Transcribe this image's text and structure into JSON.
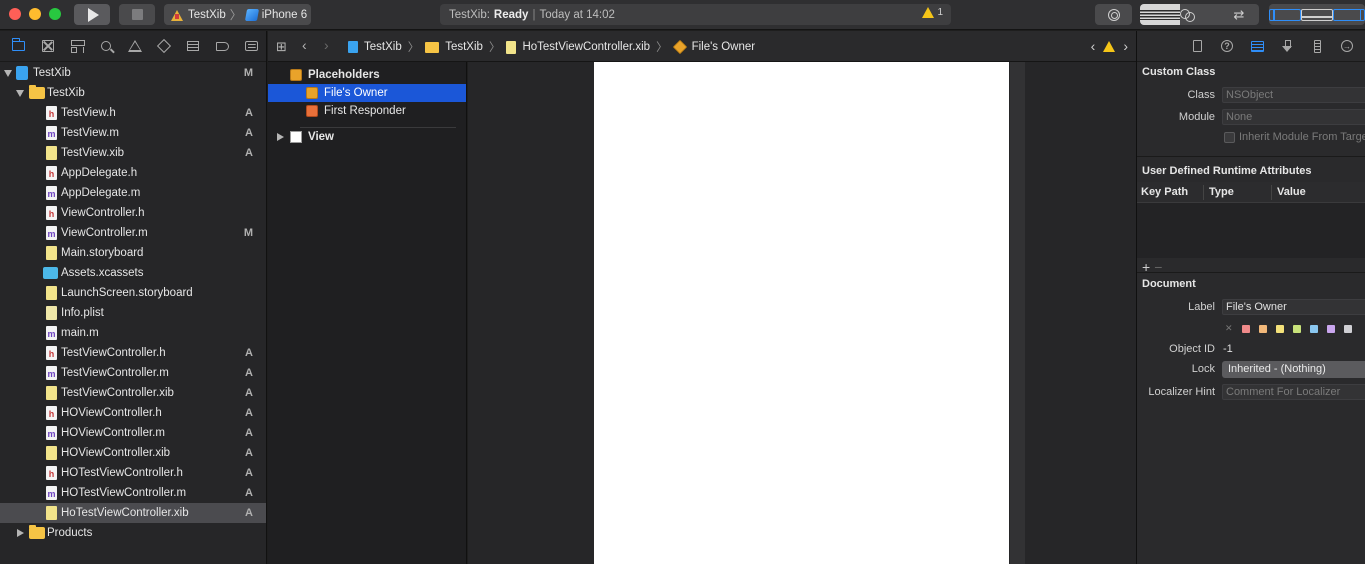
{
  "toolbar": {
    "scheme_name": "TestXib",
    "destination": "iPhone 6",
    "activity_app": "TestXib:",
    "activity_status": "Ready",
    "activity_sep": "|",
    "activity_time": "Today at 14:02",
    "warning_count": "1"
  },
  "navigator": {
    "project": {
      "name": "TestXib",
      "status": "M"
    },
    "group": {
      "name": "TestXib"
    },
    "files": [
      {
        "name": "TestView.h",
        "kind": "h",
        "status": "A"
      },
      {
        "name": "TestView.m",
        "kind": "m",
        "status": "A"
      },
      {
        "name": "TestView.xib",
        "kind": "xib",
        "status": "A"
      },
      {
        "name": "AppDelegate.h",
        "kind": "h",
        "status": ""
      },
      {
        "name": "AppDelegate.m",
        "kind": "m",
        "status": ""
      },
      {
        "name": "ViewController.h",
        "kind": "h",
        "status": ""
      },
      {
        "name": "ViewController.m",
        "kind": "m",
        "status": "M"
      },
      {
        "name": "Main.storyboard",
        "kind": "sb",
        "status": ""
      },
      {
        "name": "Assets.xcassets",
        "kind": "assets",
        "status": ""
      },
      {
        "name": "LaunchScreen.storyboard",
        "kind": "sb",
        "status": ""
      },
      {
        "name": "Info.plist",
        "kind": "plist",
        "status": ""
      },
      {
        "name": "main.m",
        "kind": "m",
        "status": ""
      },
      {
        "name": "TestViewController.h",
        "kind": "h",
        "status": "A"
      },
      {
        "name": "TestViewController.m",
        "kind": "m",
        "status": "A"
      },
      {
        "name": "TestViewController.xib",
        "kind": "xib",
        "status": "A"
      },
      {
        "name": "HOViewController.h",
        "kind": "h",
        "status": "A"
      },
      {
        "name": "HOViewController.m",
        "kind": "m",
        "status": "A"
      },
      {
        "name": "HOViewController.xib",
        "kind": "xib",
        "status": "A"
      },
      {
        "name": "HOTestViewController.h",
        "kind": "h",
        "status": "A"
      },
      {
        "name": "HOTestViewController.m",
        "kind": "m",
        "status": "A"
      },
      {
        "name": "HoTestViewController.xib",
        "kind": "xib",
        "status": "A"
      }
    ],
    "products": {
      "name": "Products"
    }
  },
  "jumpbar": {
    "crumbs": [
      "TestXib",
      "TestXib",
      "HoTestViewController.xib",
      "File's Owner"
    ]
  },
  "outline": {
    "placeholders": "Placeholders",
    "files_owner": "File's Owner",
    "first_responder": "First Responder",
    "view": "View"
  },
  "inspector": {
    "custom_class": {
      "title": "Custom Class",
      "class_label": "Class",
      "class_placeholder": "NSObject",
      "module_label": "Module",
      "module_placeholder": "None",
      "inherit_label": "Inherit Module From Target"
    },
    "runtime_attrs": {
      "title": "User Defined Runtime Attributes",
      "columns": [
        "Key Path",
        "Type",
        "Value"
      ],
      "add": "+",
      "remove": "−"
    },
    "document": {
      "title": "Document",
      "label_label": "Label",
      "label_value": "File's Owner",
      "object_id_label": "Object ID",
      "object_id_value": "-1",
      "lock_label": "Lock",
      "lock_value": "Inherited - (Nothing)",
      "hint_label": "Localizer Hint",
      "hint_placeholder": "Comment For Localizer",
      "label_colors": [
        "#f08a8a",
        "#f2b87a",
        "#f3e17a",
        "#c8e27a",
        "#8ac7f0",
        "#c9a6ee",
        "#cfcfd4"
      ]
    }
  }
}
